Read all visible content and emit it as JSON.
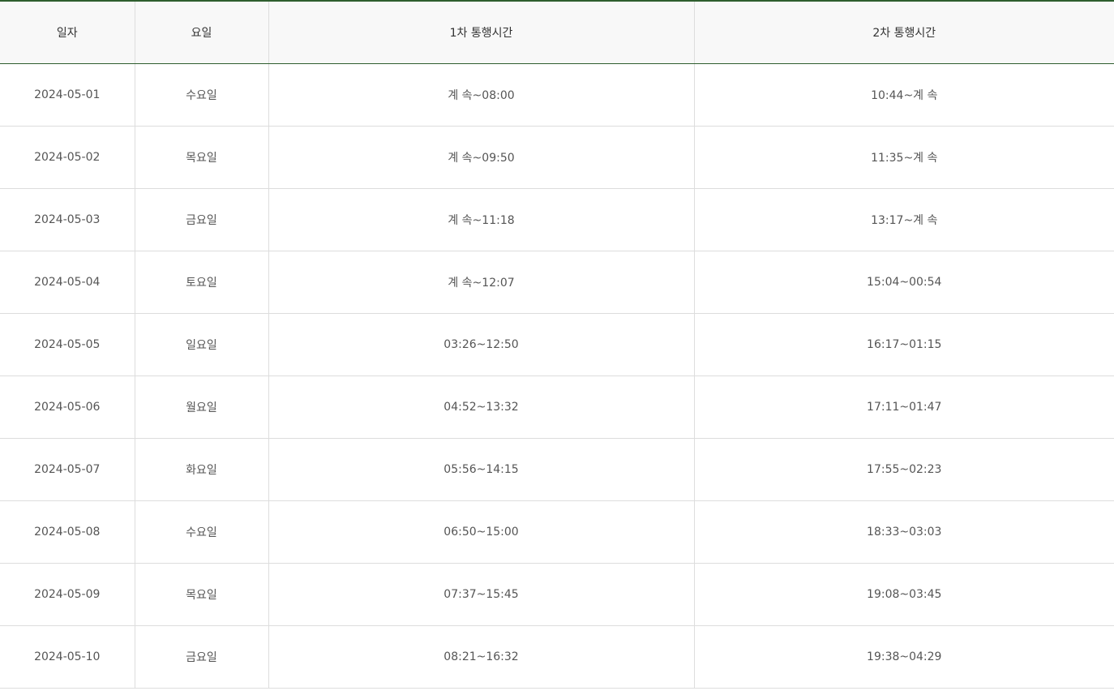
{
  "table": {
    "headers": [
      "일자",
      "요일",
      "1차 통행시간",
      "2차 통행시간"
    ],
    "rows": [
      [
        "2024-05-01",
        "수요일",
        "계 속~08:00",
        "10:44~계 속"
      ],
      [
        "2024-05-02",
        "목요일",
        "계 속~09:50",
        "11:35~계 속"
      ],
      [
        "2024-05-03",
        "금요일",
        "계 속~11:18",
        "13:17~계 속"
      ],
      [
        "2024-05-04",
        "토요일",
        "계 속~12:07",
        "15:04~00:54"
      ],
      [
        "2024-05-05",
        "일요일",
        "03:26~12:50",
        "16:17~01:15"
      ],
      [
        "2024-05-06",
        "월요일",
        "04:52~13:32",
        "17:11~01:47"
      ],
      [
        "2024-05-07",
        "화요일",
        "05:56~14:15",
        "17:55~02:23"
      ],
      [
        "2024-05-08",
        "수요일",
        "06:50~15:00",
        "18:33~03:03"
      ],
      [
        "2024-05-09",
        "목요일",
        "07:37~15:45",
        "19:08~03:45"
      ],
      [
        "2024-05-10",
        "금요일",
        "08:21~16:32",
        "19:38~04:29"
      ]
    ]
  },
  "colors": {
    "header_border": "#2e5e2e",
    "header_bg": "#f8f8f8",
    "cell_border": "#dddddd",
    "text": "#555555"
  }
}
